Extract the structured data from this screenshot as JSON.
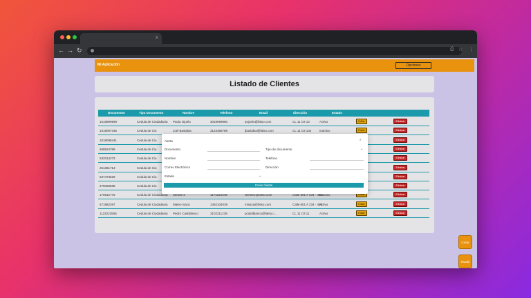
{
  "browser": {
    "tab_close": "×",
    "back": "←",
    "forward": "→",
    "reload": "↻",
    "menu": "⋮"
  },
  "app": {
    "title": "Mi Aplicación",
    "options_label": "Opciones"
  },
  "page_title": "Listado de Clientes",
  "table": {
    "headers": [
      "Documento",
      "Tipo Documento",
      "Nombre",
      "Telefono",
      "Email",
      "dirección",
      "Estado"
    ],
    "rows": [
      {
        "documento": "1018999999",
        "tipo": "Cedula de Ciudadania",
        "nombre": "Paula Ojuelo",
        "telefono": "3019999980",
        "email": "pojuelo@falso.com",
        "direccion": "CL 11 C9 13",
        "estado": "Activo"
      },
      {
        "documento": "1018097345",
        "tipo": "Cedula de Ciu",
        "nombre": "Joel Bastidas",
        "telefono": "3123456789",
        "email": "jbastidas@falso.com",
        "direccion": "CL 11 C9 134",
        "estado": "Inactivo"
      },
      {
        "documento": "1018098441",
        "tipo": "Cedula de Ciu",
        "nombre": "",
        "telefono": "",
        "email": "",
        "direccion": "",
        "estado": ""
      },
      {
        "documento": "608524789",
        "tipo": "Cedula de Ciu",
        "nombre": "",
        "telefono": "",
        "email": "",
        "direccion": "",
        "estado": ""
      },
      {
        "documento": "532014273",
        "tipo": "Cedula de Ciu",
        "nombre": "",
        "telefono": "",
        "email": "",
        "direccion": "",
        "estado": ""
      },
      {
        "documento": "251361713",
        "tipo": "Cedula de Ciu",
        "nombre": "",
        "telefono": "",
        "email": "",
        "direccion": "",
        "estado": ""
      },
      {
        "documento": "537473629",
        "tipo": "Cedula de Ciu",
        "nombre": "",
        "telefono": "",
        "email": "",
        "direccion": "",
        "estado": ""
      },
      {
        "documento": "376028688",
        "tipo": "Cedula de Ciu",
        "nombre": "",
        "telefono": "",
        "email": "",
        "direccion": "",
        "estado": ""
      },
      {
        "documento": "170812775",
        "tipo": "Cedula de Ciudadania",
        "nombre": "Cliente 2",
        "telefono": "1171222345",
        "email": "cliente1@falso.com",
        "direccion": "Calle 601 # 234 - 456",
        "estado": "Inactivo"
      },
      {
        "documento": "571882397",
        "tipo": "Cedula de Ciudadania",
        "nombre": "Mateo Isaza",
        "telefono": "1492104039",
        "email": "misaza@falso.com",
        "direccion": "Calle 601 # 234 - 456",
        "estado": "Activo"
      },
      {
        "documento": "1122222555",
        "tipo": "Cedula de Ciudadania",
        "nombre": "Pedro Castiblanco",
        "telefono": "3102211238",
        "email": "pcastiblanco@falso.c...",
        "direccion": "CL 11 C9 11",
        "estado": "Activo"
      }
    ],
    "edit_label": "Editar",
    "delete_label": "Eliminar"
  },
  "modal": {
    "title": "Alerta",
    "close": "x",
    "documento_label": "Documento",
    "tipo_label": "Tipo de documento",
    "nombre_label": "Nombre",
    "telefono_label": "Telefono",
    "email_label": "Correo Electrónico",
    "direccion_label": "Dirección",
    "estado_label": "Estado",
    "submit_label": "Crear cliente"
  },
  "floating": {
    "crear_label": "Crear",
    "modal_label": "Modal"
  },
  "colors": {
    "accent": "#e8920e",
    "teal": "#1a9aaa",
    "danger": "#c62828"
  }
}
